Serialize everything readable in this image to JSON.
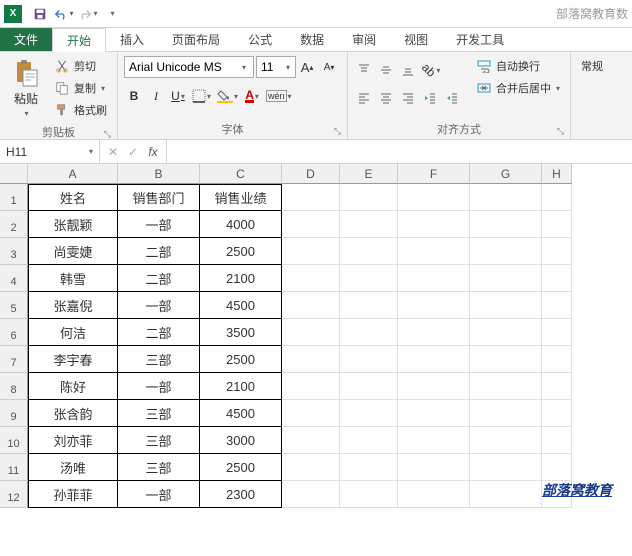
{
  "app": {
    "title": "部落窝教育数"
  },
  "tabs": {
    "file": "文件",
    "items": [
      "开始",
      "插入",
      "页面布局",
      "公式",
      "数据",
      "审阅",
      "视图",
      "开发工具"
    ],
    "activeIndex": 0
  },
  "ribbon": {
    "clipboard": {
      "label": "剪贴板",
      "paste": "粘贴",
      "cut": "剪切",
      "copy": "复制",
      "format_painter": "格式刷"
    },
    "font": {
      "label": "字体",
      "name": "Arial Unicode MS",
      "size": "11",
      "grow": "A",
      "shrink": "A",
      "bold": "B",
      "italic": "I",
      "underline": "U",
      "phonetic": "wén"
    },
    "align": {
      "label": "对齐方式",
      "wrap": "自动换行",
      "merge": "合并后居中"
    },
    "number": {
      "general": "常规"
    }
  },
  "namebox": "H11",
  "fx_label": "fx",
  "columns": [
    "A",
    "B",
    "C",
    "D",
    "E",
    "F",
    "G",
    "H"
  ],
  "table": {
    "headers": [
      "姓名",
      "销售部门",
      "销售业绩"
    ],
    "rows": [
      [
        "张靓颖",
        "一部",
        "4000"
      ],
      [
        "尚雯婕",
        "二部",
        "2500"
      ],
      [
        "韩雪",
        "二部",
        "2100"
      ],
      [
        "张嘉倪",
        "一部",
        "4500"
      ],
      [
        "何洁",
        "二部",
        "3500"
      ],
      [
        "李宇春",
        "三部",
        "2500"
      ],
      [
        "陈好",
        "一部",
        "2100"
      ],
      [
        "张含韵",
        "三部",
        "4500"
      ],
      [
        "刘亦菲",
        "三部",
        "3000"
      ],
      [
        "汤唯",
        "三部",
        "2500"
      ],
      [
        "孙菲菲",
        "一部",
        "2300"
      ]
    ]
  },
  "watermark": "部落窝教育"
}
